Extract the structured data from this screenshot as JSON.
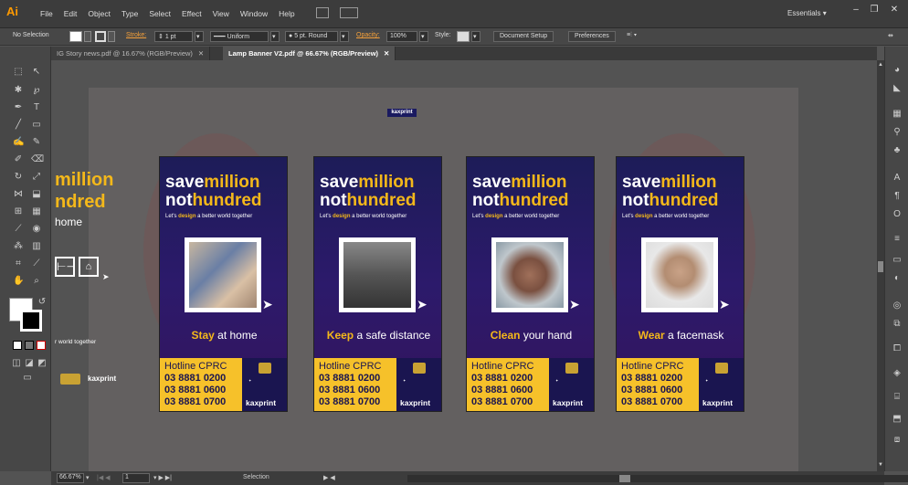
{
  "app": {
    "logo": "Ai",
    "workspace": "Essentials"
  },
  "menu": [
    "File",
    "Edit",
    "Object",
    "Type",
    "Select",
    "Effect",
    "View",
    "Window",
    "Help"
  ],
  "control": {
    "selection": "No Selection",
    "stroke_label": "Stroke:",
    "stroke_value": "1 pt",
    "profile": "Uniform",
    "brush": "5 pt. Round",
    "opacity_label": "Opacity:",
    "opacity_value": "100%",
    "style_label": "Style:",
    "doc_setup": "Document Setup",
    "preferences": "Preferences"
  },
  "tabs": [
    {
      "label": "IG Story news.pdf @ 16.67% (RGB/Preview)",
      "active": false
    },
    {
      "label": "Lamp Banner V2.pdf @ 66.67% (RGB/Preview)",
      "active": true
    }
  ],
  "artboard": {
    "kaxprint_top": "kaxprint",
    "left_fragment": {
      "line1": "million",
      "line2": "ndred",
      "line3": "home",
      "tag": "r world together",
      "kax": "kaxprint"
    }
  },
  "posters": [
    {
      "save": "save",
      "million": "million",
      "not": "not",
      "hundred": "hundred",
      "tag_pre": "Let's ",
      "tag_design": "design",
      "tag_post": " a better world together",
      "caption_bold": "Stay",
      "caption_rest": " at home",
      "hotline": "Hotline CPRC",
      "phones": [
        "03 8881 0200",
        "03 8881 0600",
        "03 8881 0700"
      ],
      "kax": "kaxprint"
    },
    {
      "save": "save",
      "million": "million",
      "not": "not",
      "hundred": "hundred",
      "tag_pre": "Let's ",
      "tag_design": "design",
      "tag_post": " a better world together",
      "caption_bold": "Keep",
      "caption_rest": " a safe distance",
      "hotline": "Hotline CPRC",
      "phones": [
        "03 8881 0200",
        "03 8881 0600",
        "03 8881 0700"
      ],
      "kax": "kaxprint"
    },
    {
      "save": "save",
      "million": "million",
      "not": "not",
      "hundred": "hundred",
      "tag_pre": "Let's ",
      "tag_design": "design",
      "tag_post": " a better world together",
      "caption_bold": "Clean",
      "caption_rest": " your hand",
      "hotline": "Hotline CPRC",
      "phones": [
        "03 8881 0200",
        "03 8881 0600",
        "03 8881 0700"
      ],
      "kax": "kaxprint"
    },
    {
      "save": "save",
      "million": "million",
      "not": "not",
      "hundred": "hundred",
      "tag_pre": "Let's ",
      "tag_design": "design",
      "tag_post": " a better world together",
      "caption_bold": "Wear",
      "caption_rest": " a facemask",
      "hotline": "Hotline CPRC",
      "phones": [
        "03 8881 0200",
        "03 8881 0600",
        "03 8881 0700"
      ],
      "kax": "kaxprint"
    }
  ],
  "status": {
    "zoom": "66.67%",
    "page": "1",
    "tool": "Selection"
  },
  "colors": {
    "accent_yellow": "#f4b81a",
    "poster_navy": "#1d1c58",
    "ai_orange": "#ff9a00"
  }
}
